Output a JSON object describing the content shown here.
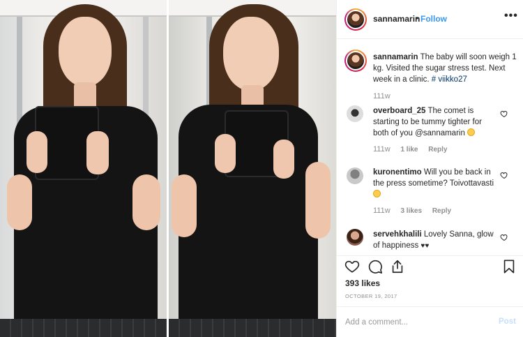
{
  "header": {
    "username": "sannamarin",
    "separator": "•",
    "follow_label": "Follow",
    "more_label": "•••"
  },
  "caption": {
    "username": "sannamarin",
    "text": "The baby will soon weigh 1 kg. Visited the sugar stress test. Next week in a clinic. ",
    "hashtag": "# viikko27",
    "time": "111w"
  },
  "comments": [
    {
      "username": "overboard_25",
      "text": "The comet is starting to be tummy tighter for both of you @sannamarin",
      "time": "111w",
      "likes": "1 like",
      "reply": "Reply"
    },
    {
      "username": "kuronentimo",
      "text": "Will you be back in the press sometime? Toivottavasti",
      "time": "111w",
      "likes": "3 likes",
      "reply": "Reply"
    },
    {
      "username": "servehkhalili",
      "text": "Lovely Sanna, glow of happiness",
      "hearts": "♥♥"
    }
  ],
  "actions": {
    "likes_count": "393 likes",
    "date": "October 19, 2017",
    "add_comment_placeholder": "Add a comment...",
    "post_label": "Post"
  },
  "colors": {
    "link_blue": "#3897f0",
    "post_disabled": "#c7dffa",
    "muted_text": "#8e8e8e"
  },
  "icons": [
    "heart-icon",
    "comment-icon",
    "share-icon",
    "bookmark-icon",
    "more-icon"
  ]
}
